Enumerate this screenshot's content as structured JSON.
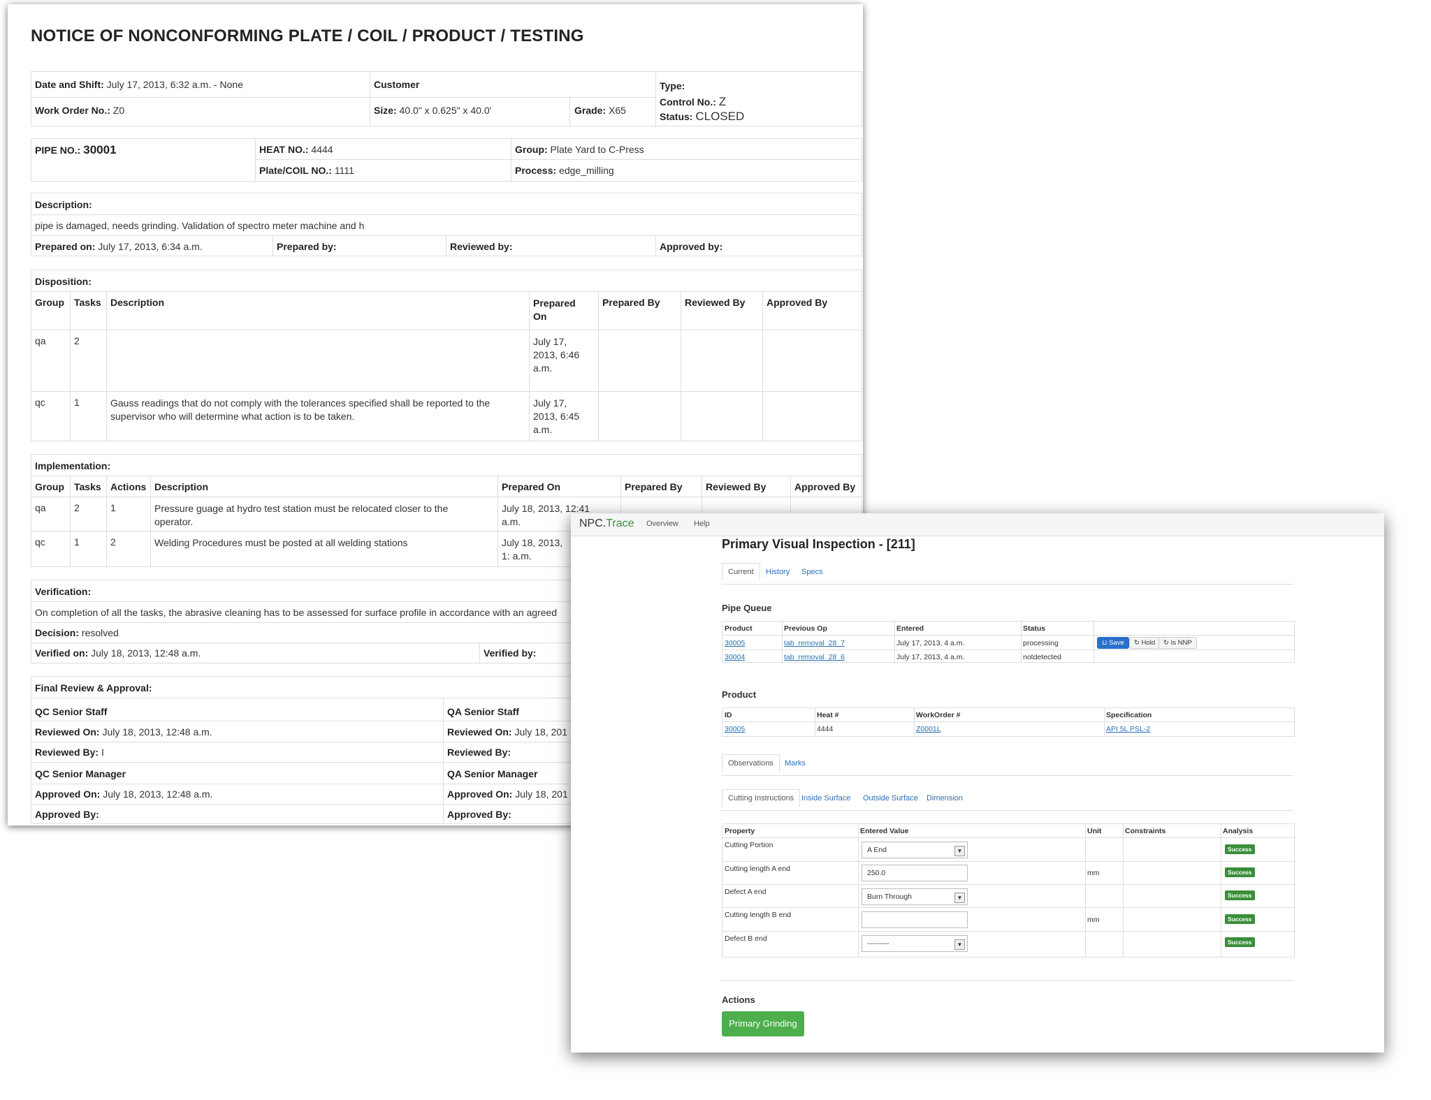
{
  "doc": {
    "title": "NOTICE OF NONCONFORMING PLATE / COIL / PRODUCT / TESTING",
    "header": {
      "date_shift_label": "Date and Shift:",
      "date_shift_value": "July 17, 2013, 6:32 a.m. - None",
      "customer_label": "Customer",
      "work_order_label": "Work Order No.:",
      "work_order_value": "Z0",
      "size_label": "Size:",
      "size_value": "40.0\" x 0.625\" x 40.0'",
      "grade_label": "Grade:",
      "grade_value": "X65",
      "type_label": "Type:",
      "control_label": "Control No.:",
      "control_value": "Z",
      "status_label": "Status:",
      "status_value": "CLOSED"
    },
    "pipe": {
      "pipe_label": "PIPE NO.:",
      "pipe_value": "30001",
      "heat_label": "HEAT NO.:",
      "heat_value": "4444",
      "group_label": "Group:",
      "group_value": "Plate Yard to C-Press",
      "plate_label": "Plate/COIL NO.:",
      "plate_value": "1111",
      "process_label": "Process:",
      "process_value": "edge_milling"
    },
    "description": {
      "label": "Description:",
      "text": "pipe is damaged, needs grinding. Validation of spectro meter machine and h",
      "prepared_on_label": "Prepared on:",
      "prepared_on_value": "July 17, 2013, 6:34 a.m.",
      "prepared_by_label": "Prepared by:",
      "reviewed_by_label": "Reviewed by:",
      "approved_by_label": "Approved by:"
    },
    "disposition": {
      "label": "Disposition:",
      "headers": [
        "Group",
        "Tasks",
        "Description",
        "Prepared On",
        "Prepared By",
        "Reviewed By",
        "Approved By"
      ],
      "rows": [
        {
          "group": "qa",
          "tasks": "2",
          "description": "",
          "prepared_on": "July 17, 2013, 6:46 a.m."
        },
        {
          "group": "qc",
          "tasks": "1",
          "description": "Gauss readings that do not comply with the tolerances specified shall be reported to the supervisor who will determine what action is to be taken.",
          "prepared_on": "July 17, 2013, 6:45 a.m."
        }
      ]
    },
    "implementation": {
      "label": "Implementation:",
      "headers": [
        "Group",
        "Tasks",
        "Actions",
        "Description",
        "Prepared On",
        "Prepared By",
        "Reviewed By",
        "Approved By"
      ],
      "rows": [
        {
          "group": "qa",
          "tasks": "2",
          "actions": "1",
          "description": "Pressure guage at hydro test station must be relocated closer to the operator.",
          "prepared_on": "July 18, 2013, 12:41 a.m."
        },
        {
          "group": "qc",
          "tasks": "1",
          "actions": "2",
          "description": "Welding Procedures must be posted at all welding stations",
          "prepared_on": "July 18, 2013, 1: a.m."
        }
      ]
    },
    "verification": {
      "label": "Verification:",
      "text": "On completion of all the tasks, the abrasive cleaning has to be assessed for surface profile in accordance with an agreed",
      "decision_label": "Decision:",
      "decision_value": "resolved",
      "verified_on_label": "Verified on:",
      "verified_on_value": "July 18, 2013, 12:48 a.m.",
      "verified_by_label": "Verified by:"
    },
    "final": {
      "label": "Final Review & Approval:",
      "qc_staff": "QC Senior Staff",
      "qa_staff": "QA Senior Staff",
      "reviewed_on_label": "Reviewed On:",
      "qc_reviewed_on": "July 18, 2013, 12:48 a.m.",
      "qa_reviewed_on": "July 18, 201",
      "reviewed_by_label": "Reviewed By:",
      "qc_reviewed_by": "I",
      "qc_manager": "QC Senior Manager",
      "qa_manager": "QA Senior Manager",
      "approved_on_label": "Approved On:",
      "qc_approved_on": "July 18, 2013, 12:48 a.m.",
      "qa_approved_on": "July 18, 201",
      "approved_by_label": "Approved By:"
    }
  },
  "app": {
    "brand_prefix": "NPC.",
    "brand_suffix": "Trace",
    "brand_suffix_color": "#3a8e3a",
    "nav": [
      "Overview",
      "Help"
    ],
    "page_title": "Primary Visual Inspection - [211]",
    "tabs": [
      "Current",
      "History",
      "Specs"
    ],
    "queue": {
      "title": "Pipe Queue",
      "headers": [
        "Product",
        "Previous Op",
        "Entered",
        "Status"
      ],
      "rows": [
        {
          "product": "30005",
          "previous_op": "tab_removal_28_7",
          "entered": "July 17, 2013, 4 a.m.",
          "status": "processing"
        },
        {
          "product": "30004",
          "previous_op": "tab_removal_28_6",
          "entered": "July 17, 2013, 4 a.m.",
          "status": "notdetected"
        }
      ],
      "buttons": {
        "save": "Save",
        "hold": "Hold",
        "nnp": "Is NNP"
      }
    },
    "product": {
      "title": "Product",
      "headers": [
        "ID",
        "Heat #",
        "WorkOrder #",
        "Specification"
      ],
      "row": {
        "id": "30005",
        "heat": "4444",
        "workorder": "Z0001L",
        "spec": "API 5L PSL-2"
      }
    },
    "obs_tabs": [
      "Observations",
      "Marks"
    ],
    "sub_tabs": [
      "Cutting Instructions",
      "Inside Surface",
      "Outside Surface",
      "Dimension"
    ],
    "props": {
      "headers": [
        "Property",
        "Entered Value",
        "Unit",
        "Constraints",
        "Analysis"
      ],
      "rows": [
        {
          "property": "Cutting Portion",
          "value": "A End",
          "unit": "",
          "analysis": "Success"
        },
        {
          "property": "Cutting length A end",
          "value": "250.0",
          "unit": "mm",
          "analysis": "Success"
        },
        {
          "property": "Defect A end",
          "value": "Burn Through",
          "unit": "",
          "analysis": "Success"
        },
        {
          "property": "Cutting length B end",
          "value": "",
          "unit": "mm",
          "analysis": "Success"
        },
        {
          "property": "Defect B end",
          "value": "---------",
          "unit": "",
          "analysis": "Success"
        }
      ]
    },
    "actions": {
      "title": "Actions",
      "button": "Primary Grinding"
    }
  }
}
